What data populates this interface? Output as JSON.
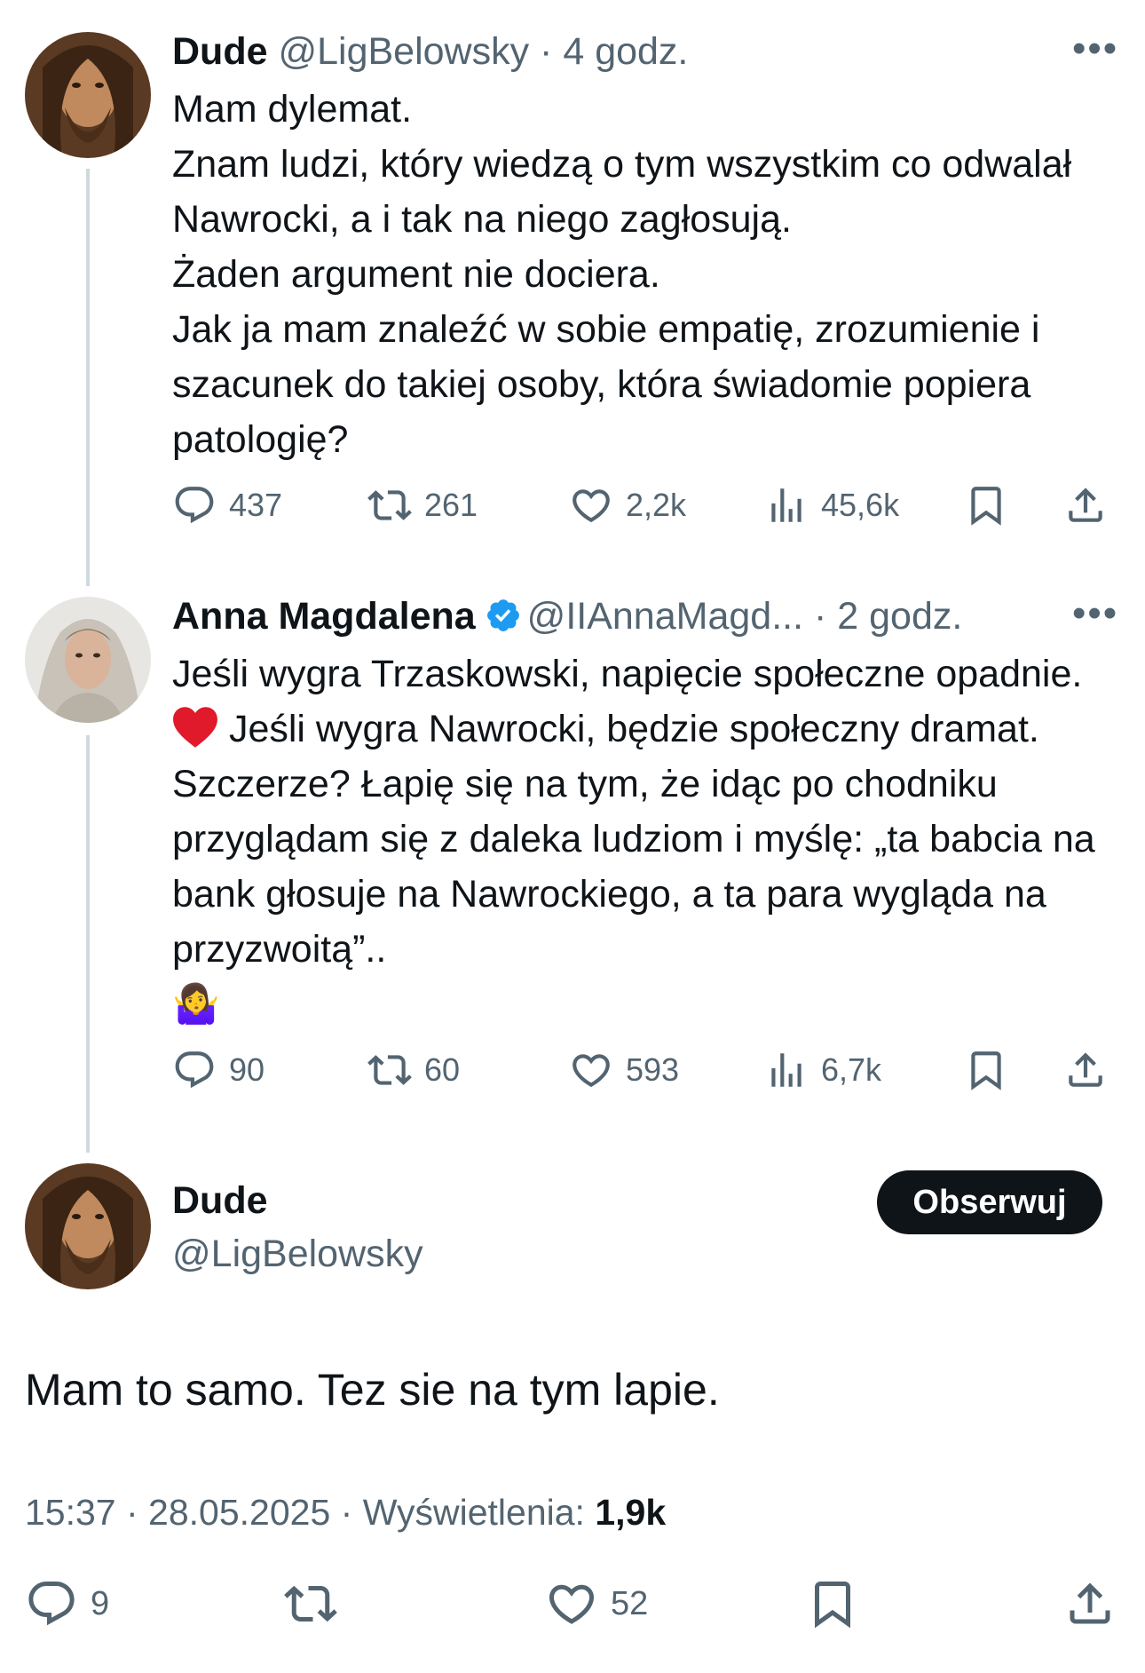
{
  "tweet1": {
    "name": "Dude",
    "handle": "@LigBelowsky",
    "time": "4 godz.",
    "text_lines": [
      "Mam dylemat.",
      "Znam ludzi, który wiedzą o tym wszystkim co odwalał Nawrocki, a i tak na niego zagłosują.",
      "Żaden argument nie dociera.",
      "Jak ja mam znaleźć w sobie empatię, zrozumienie i szacunek do takiej osoby, która świadomie popiera patologię?"
    ],
    "replies": "437",
    "retweets": "261",
    "likes": "2,2k",
    "views": "45,6k"
  },
  "tweet2": {
    "name": "Anna Magdalena",
    "handle": "@IIAnnaMagd...",
    "time": "2 godz.",
    "text_part1": "Jeśli wygra Trzaskowski, napięcie społeczne opadnie.",
    "text_part2": "Jeśli wygra Nawrocki, będzie społeczny dramat. Szczerze? Łapię się na tym, że idąc po chodniku przyglądam się z daleka ludziom i myślę: „ta babcia na bank głosuje na Nawrockiego, a ta para wygląda na przyzwoitą”..",
    "emoji_end": "🤷‍♀️",
    "replies": "90",
    "retweets": "60",
    "likes": "593",
    "views": "6,7k"
  },
  "main": {
    "name": "Dude",
    "handle": "@LigBelowsky",
    "follow_label": "Obserwuj",
    "text": "Mam to samo. Tez sie na tym lapie.",
    "time": "15:37",
    "date": "28.05.2025",
    "views_label": "Wyświetlenia:",
    "views": "1,9k",
    "replies": "9",
    "likes": "52"
  },
  "colors": {
    "text": "#0f1419",
    "muted": "#536471",
    "verified": "#1d9bf0",
    "line": "#cfd9de"
  },
  "icons": [
    "more-icon",
    "reply-icon",
    "retweet-icon",
    "like-icon",
    "views-icon",
    "bookmark-icon",
    "share-icon",
    "verified-icon",
    "heart-emoji"
  ]
}
